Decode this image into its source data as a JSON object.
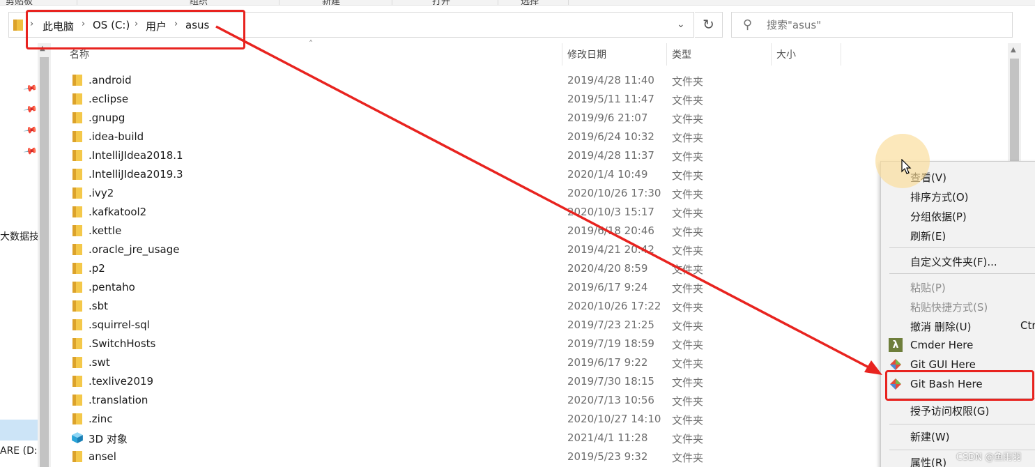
{
  "ribbon": {
    "labels": [
      "剪贴板",
      "组织",
      "新建",
      "打开",
      "选择"
    ]
  },
  "address": {
    "crumbs": [
      "此电脑",
      "OS (C:)",
      "用户",
      "asus"
    ]
  },
  "search": {
    "placeholder": "搜索\"asus\""
  },
  "nav": {
    "partial_items": [
      "大数据技术",
      "ARE (D:)"
    ]
  },
  "columns": {
    "name": "名称",
    "date": "修改日期",
    "type": "类型",
    "size": "大小"
  },
  "files": [
    {
      "name": ".android",
      "date": "2019/4/28 11:40",
      "type": "文件夹",
      "icon": "folder-icon"
    },
    {
      "name": ".eclipse",
      "date": "2019/5/11 11:47",
      "type": "文件夹",
      "icon": "folder-icon"
    },
    {
      "name": ".gnupg",
      "date": "2019/9/6 21:07",
      "type": "文件夹",
      "icon": "folder-icon"
    },
    {
      "name": ".idea-build",
      "date": "2019/6/24 10:32",
      "type": "文件夹",
      "icon": "folder-icon"
    },
    {
      "name": ".IntelliJIdea2018.1",
      "date": "2019/4/28 11:37",
      "type": "文件夹",
      "icon": "folder-icon"
    },
    {
      "name": ".IntelliJIdea2019.3",
      "date": "2020/1/4 10:49",
      "type": "文件夹",
      "icon": "folder-icon"
    },
    {
      "name": ".ivy2",
      "date": "2020/10/26 17:30",
      "type": "文件夹",
      "icon": "folder-icon"
    },
    {
      "name": ".kafkatool2",
      "date": "2020/10/3 15:17",
      "type": "文件夹",
      "icon": "folder-icon"
    },
    {
      "name": ".kettle",
      "date": "2019/6/18 20:46",
      "type": "文件夹",
      "icon": "folder-icon"
    },
    {
      "name": ".oracle_jre_usage",
      "date": "2019/4/21 20:42",
      "type": "文件夹",
      "icon": "folder-icon"
    },
    {
      "name": ".p2",
      "date": "2020/4/20 8:59",
      "type": "文件夹",
      "icon": "folder-icon"
    },
    {
      "name": ".pentaho",
      "date": "2019/6/17 9:24",
      "type": "文件夹",
      "icon": "folder-icon"
    },
    {
      "name": ".sbt",
      "date": "2020/10/26 17:22",
      "type": "文件夹",
      "icon": "folder-icon"
    },
    {
      "name": ".squirrel-sql",
      "date": "2019/7/23 21:25",
      "type": "文件夹",
      "icon": "folder-icon"
    },
    {
      "name": ".SwitchHosts",
      "date": "2019/7/19 18:59",
      "type": "文件夹",
      "icon": "folder-icon"
    },
    {
      "name": ".swt",
      "date": "2019/6/17 9:22",
      "type": "文件夹",
      "icon": "folder-icon"
    },
    {
      "name": ".texlive2019",
      "date": "2019/7/30 18:15",
      "type": "文件夹",
      "icon": "folder-icon"
    },
    {
      "name": ".translation",
      "date": "2020/7/13 10:56",
      "type": "文件夹",
      "icon": "folder-icon"
    },
    {
      "name": ".zinc",
      "date": "2020/10/27 14:10",
      "type": "文件夹",
      "icon": "folder-icon"
    },
    {
      "name": "3D 对象",
      "date": "2021/4/1 11:28",
      "type": "文件夹",
      "icon": "3d-objects-icon"
    },
    {
      "name": "ansel",
      "date": "2019/5/23 9:32",
      "type": "文件夹",
      "icon": "folder-icon"
    }
  ],
  "context_menu": {
    "view": "查看(V)",
    "sort": "排序方式(O)",
    "group": "分组依据(P)",
    "refresh": "刷新(E)",
    "customize": "自定义文件夹(F)...",
    "paste": "粘贴(P)",
    "paste_shortcut": "粘贴快捷方式(S)",
    "undo_delete": "撤消 删除(U)",
    "undo_shortcut": "Ctr",
    "cmder": "Cmder Here",
    "git_gui": "Git GUI Here",
    "git_bash": "Git Bash Here",
    "grant_access": "授予访问权限(G)",
    "new": "新建(W)",
    "properties": "属性(R)"
  },
  "annotation_color": "#e8231f",
  "watermark": "CSDN @鱼雨羽"
}
